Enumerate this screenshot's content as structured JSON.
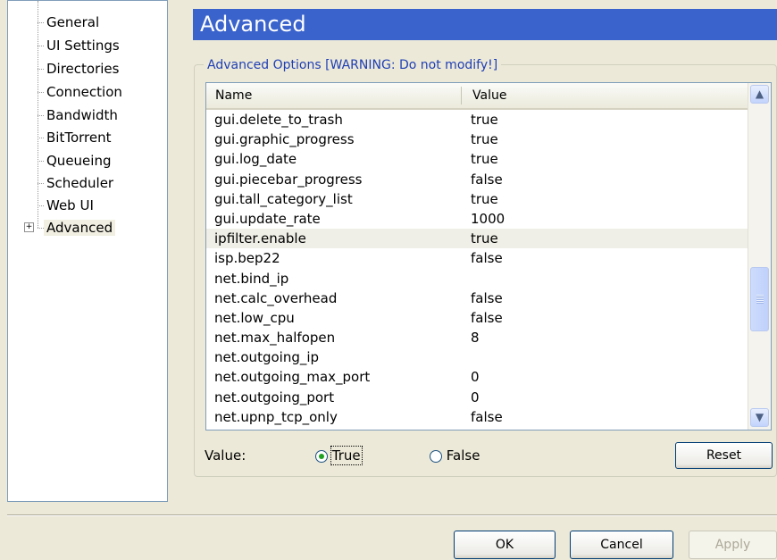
{
  "tree": {
    "items": [
      {
        "label": "General"
      },
      {
        "label": "UI Settings"
      },
      {
        "label": "Directories"
      },
      {
        "label": "Connection"
      },
      {
        "label": "Bandwidth"
      },
      {
        "label": "BitTorrent"
      },
      {
        "label": "Queueing"
      },
      {
        "label": "Scheduler"
      },
      {
        "label": "Web UI"
      },
      {
        "label": "Advanced"
      }
    ],
    "expander_symbol": "+"
  },
  "header": {
    "title": "Advanced"
  },
  "group": {
    "title": "Advanced Options [WARNING: Do not modify!]"
  },
  "table": {
    "columns": {
      "name": "Name",
      "value": "Value"
    },
    "rows": [
      {
        "name": "gui.delete_to_trash",
        "value": "true"
      },
      {
        "name": "gui.graphic_progress",
        "value": "true"
      },
      {
        "name": "gui.log_date",
        "value": "true"
      },
      {
        "name": "gui.piecebar_progress",
        "value": "false"
      },
      {
        "name": "gui.tall_category_list",
        "value": "true"
      },
      {
        "name": "gui.update_rate",
        "value": "1000"
      },
      {
        "name": "ipfilter.enable",
        "value": "true"
      },
      {
        "name": "isp.bep22",
        "value": "false"
      },
      {
        "name": "net.bind_ip",
        "value": ""
      },
      {
        "name": "net.calc_overhead",
        "value": "false"
      },
      {
        "name": "net.low_cpu",
        "value": "false"
      },
      {
        "name": "net.max_halfopen",
        "value": "8"
      },
      {
        "name": "net.outgoing_ip",
        "value": ""
      },
      {
        "name": "net.outgoing_max_port",
        "value": "0"
      },
      {
        "name": "net.outgoing_port",
        "value": "0"
      },
      {
        "name": "net.upnp_tcp_only",
        "value": "false"
      }
    ],
    "selected_row": "ipfilter.enable"
  },
  "editor": {
    "label": "Value:",
    "true_label": "True",
    "false_label": "False",
    "selected": "True",
    "reset_label": "Reset"
  },
  "footer": {
    "ok_label": "OK",
    "cancel_label": "Cancel",
    "apply_label": "Apply"
  }
}
